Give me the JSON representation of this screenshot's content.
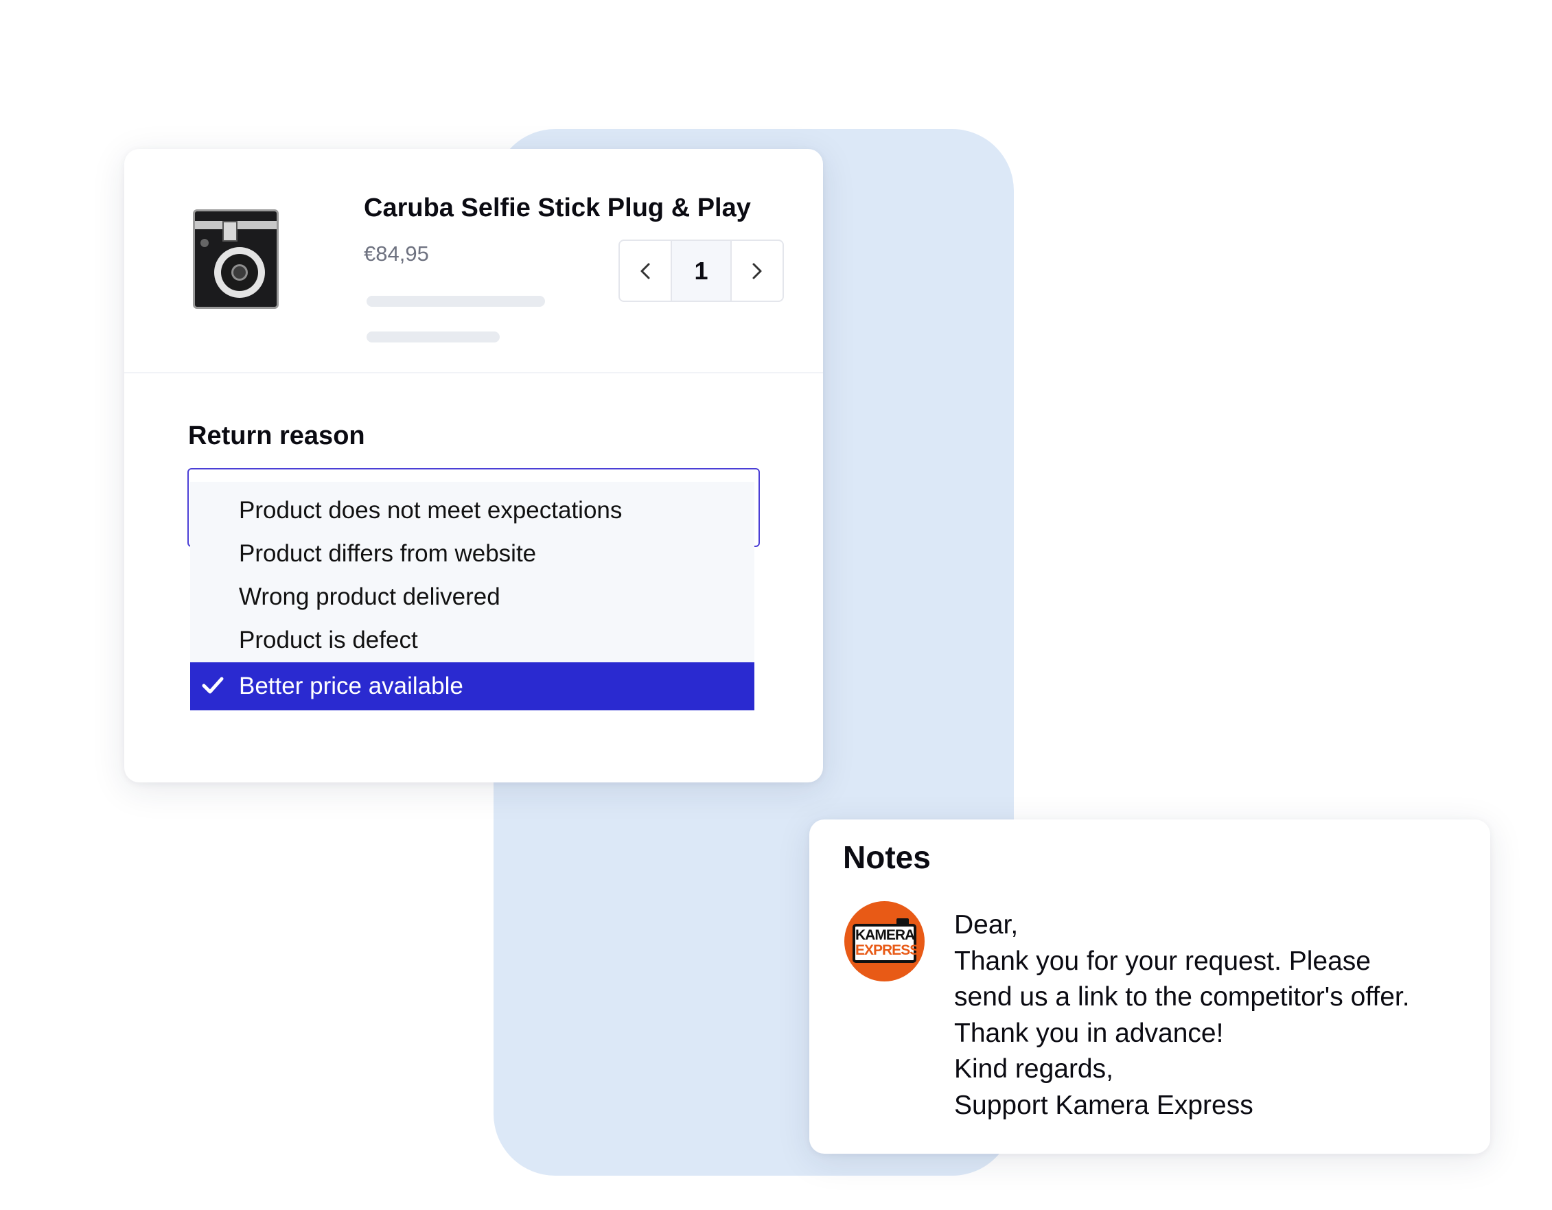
{
  "product": {
    "title": "Caruba Selfie Stick Plug & Play",
    "price": "€84,95",
    "quantity": "1",
    "image_icon": "instant-camera-image"
  },
  "return_reason": {
    "label": "Return reason",
    "options": [
      "Product does not meet expectations",
      "Product differs from website",
      "Wrong product delivered",
      "Product is defect",
      "Better price available"
    ],
    "selected": "Better price available",
    "accent_color": "#2a2ad0"
  },
  "notes": {
    "title": "Notes",
    "logo_text_line1": "KAMERA",
    "logo_text_line2": "EXPRESS",
    "logo_color": "#e85a16",
    "message_lines": [
      "Dear,",
      "Thank you for your request. Please",
      "send us a link to the competitor's offer.",
      "Thank you in advance!",
      "Kind regards,",
      "Support Kamera Express"
    ]
  },
  "colors": {
    "background_shape": "#dce8f7",
    "select_border": "#4b3fd6"
  }
}
